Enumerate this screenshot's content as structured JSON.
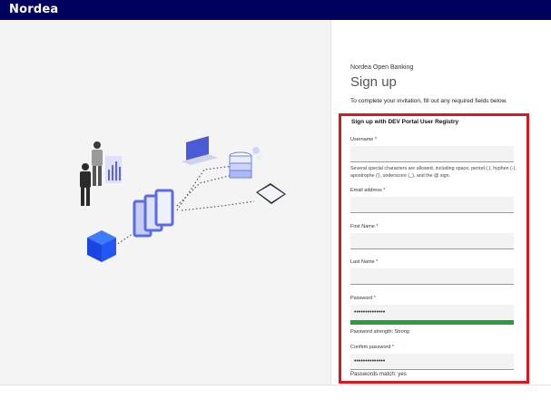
{
  "header": {
    "logo": "Nordea"
  },
  "intro": {
    "subtitle": "Nordea Open Banking",
    "title": "Sign up",
    "text": "To complete your invitation, fill out any required fields below."
  },
  "form": {
    "heading": "Sign up with DEV Portal User Registry",
    "username": {
      "label": "Username",
      "required_mark": "*",
      "value": "",
      "help": "Several special characters are allowed, including space, period (.), hyphen (-), apostrophe ('), underscore (_), and the @ sign."
    },
    "email": {
      "label": "Email address",
      "required_mark": "*",
      "value": ""
    },
    "first_name": {
      "label": "First Name",
      "required_mark": "*",
      "value": ""
    },
    "last_name": {
      "label": "Last Name",
      "required_mark": "*",
      "value": ""
    },
    "password": {
      "label": "Password",
      "required_mark": "*",
      "value": "••••••••••••••",
      "strength_text": "Password strength: Strong",
      "strength_level": 1.0
    },
    "confirm_password": {
      "label": "Confirm password",
      "required_mark": "*",
      "value": "••••••••••••••",
      "match_text": "Passwords match: yes"
    }
  },
  "colors": {
    "header_bg": "#00005e",
    "highlight_border": "#e0151c",
    "strength_strong": "#2a9d3d",
    "required": "#d6001c"
  }
}
